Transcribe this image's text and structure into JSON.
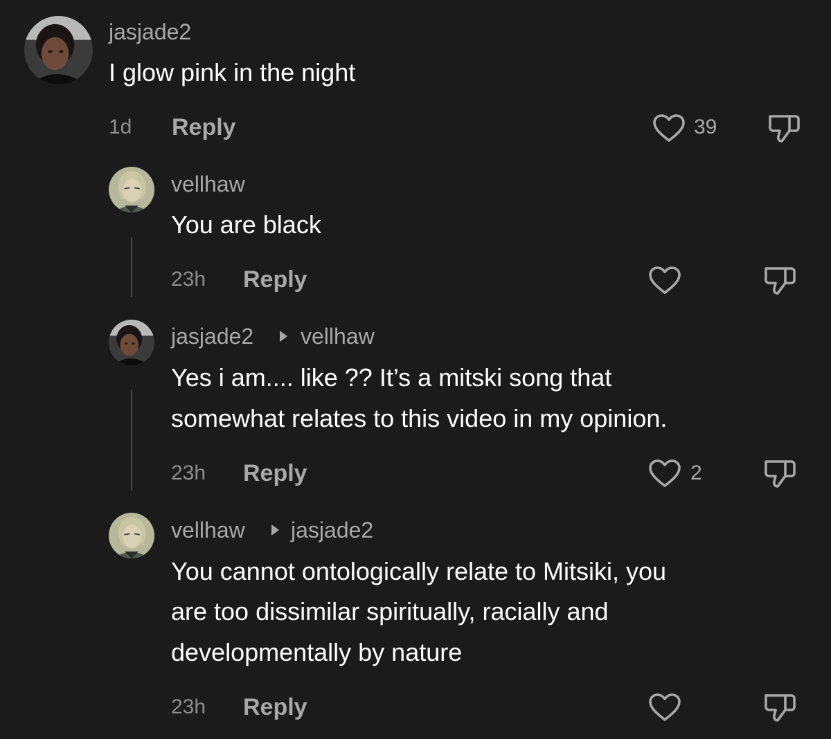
{
  "comments": [
    {
      "username": "jasjade2",
      "text_lines": [
        "I glow pink in the night"
      ],
      "time": "1d",
      "reply_label": "Reply",
      "likes": "39",
      "avatar": "profile-photo"
    },
    {
      "username": "vellhaw",
      "text_lines": [
        "You are black"
      ],
      "time": "23h",
      "reply_label": "Reply",
      "likes": "",
      "avatar": "anime-character"
    },
    {
      "username": "jasjade2",
      "reply_to": "vellhaw",
      "text_lines": [
        "Yes i am.... like ?? It’s a mitski song that",
        "somewhat relates to this video in my opinion."
      ],
      "time": "23h",
      "reply_label": "Reply",
      "likes": "2",
      "avatar": "profile-photo"
    },
    {
      "username": "vellhaw",
      "reply_to": "jasjade2",
      "text_lines": [
        "You cannot ontologically relate to Mitsiki, you",
        "are too dissimilar spiritually, racially and",
        "developmentally by nature"
      ],
      "time": "23h",
      "reply_label": "Reply",
      "likes": "",
      "avatar": "anime-character"
    }
  ],
  "icons": {
    "like": "heart-outline-icon",
    "dislike": "thumbs-down-icon",
    "reply_caret": "caret-right-icon"
  },
  "colors": {
    "background": "#1b1b1b",
    "text": "#ffffff",
    "secondary": "#a8a8a8",
    "thread_line": "#4a4a4a"
  }
}
